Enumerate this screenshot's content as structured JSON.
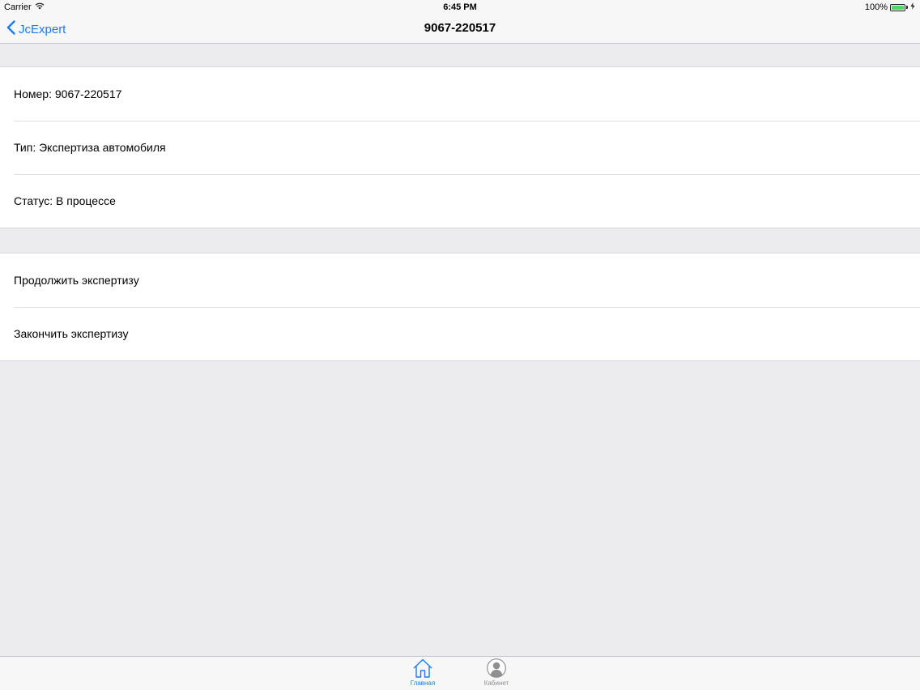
{
  "status_bar": {
    "carrier": "Carrier",
    "time": "6:45 PM",
    "battery": "100%"
  },
  "nav": {
    "back_label": "JcExpert",
    "title": "9067-220517"
  },
  "info_section": {
    "rows": [
      "Номер: 9067-220517",
      "Тип: Экспертиза автомобиля",
      "Статус: В процессе"
    ]
  },
  "action_section": {
    "rows": [
      "Продолжить экспертизу",
      "Закончить экспертизу"
    ]
  },
  "tab_bar": {
    "tabs": [
      {
        "label": "Главная",
        "icon": "home-icon",
        "selected": true
      },
      {
        "label": "Кабинет",
        "icon": "user-icon",
        "selected": false
      }
    ]
  },
  "colors": {
    "accent": "#1a7cf2",
    "battery": "#4cd964",
    "background": "#ebebf0"
  }
}
